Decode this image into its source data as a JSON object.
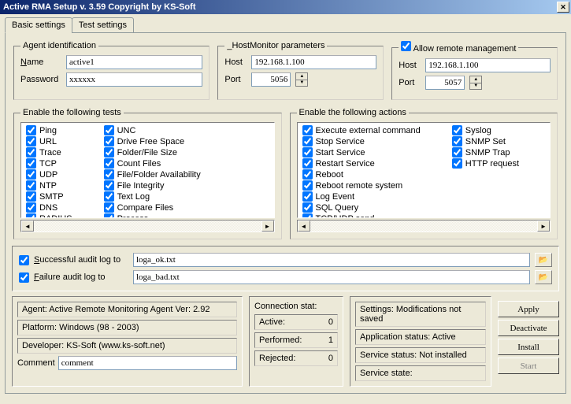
{
  "title": "Active RMA Setup   v. 3.59   Copyright by KS-Soft",
  "tabs": {
    "basic": "Basic settings",
    "test": "Test settings"
  },
  "agent_id": {
    "legend": "Agent identification",
    "name_label": "Name",
    "name_value": "active1",
    "password_label": "Password",
    "password_value": "xxxxxx"
  },
  "hostmonitor": {
    "legend": "_HostMonitor parameters",
    "host_label": "Host",
    "host_value": "192.168.1.100",
    "port_label": "Port",
    "port_value": "5056"
  },
  "remote": {
    "allow": "Allow remote management",
    "host_label": "Host",
    "host_value": "192.168.1.100",
    "port_label": "Port",
    "port_value": "5057"
  },
  "tests": {
    "legend": "Enable the following tests",
    "col1": [
      "Ping",
      "URL",
      "Trace",
      "TCP",
      "UDP",
      "NTP",
      "SMTP",
      "DNS",
      "RADIUS"
    ],
    "col2": [
      "UNC",
      "Drive Free Space",
      "Folder/File Size",
      "Count Files",
      "File/Folder Availability",
      "File Integrity",
      "Text Log",
      "Compare Files",
      "Process"
    ]
  },
  "actions": {
    "legend": "Enable the following actions",
    "col1": [
      "Execute external command",
      "Stop Service",
      "Start Service",
      "Restart Service",
      "Reboot",
      "Reboot remote system",
      "Log Event",
      "SQL Query",
      "TCP/UDP send"
    ],
    "col2": [
      "Syslog",
      "SNMP Set",
      "SNMP Trap",
      "HTTP request"
    ]
  },
  "audit": {
    "success_label": "Successful audit log to",
    "success_value": "loga_ok.txt",
    "failure_label": "Failure audit log to",
    "failure_value": "loga_bad.txt"
  },
  "info": {
    "agent": "Agent: Active Remote Monitoring Agent       Ver: 2.92",
    "platform": "Platform: Windows (98 - 2003)",
    "developer": "Developer: KS-Soft (www.ks-soft.net)",
    "comment_label": "Comment",
    "comment_value": "comment"
  },
  "stats": {
    "legend": "Connection stat:",
    "active_label": "Active:",
    "active_value": "0",
    "performed_label": "Performed:",
    "performed_value": "1",
    "rejected_label": "Rejected:",
    "rejected_value": "0"
  },
  "status": {
    "settings": "Settings: Modifications not saved",
    "app": "Application status: Active",
    "service": "Service status: Not installed",
    "state": "Service state:"
  },
  "buttons": {
    "apply": "Apply",
    "deactivate": "Deactivate",
    "install": "Install",
    "start": "Start"
  }
}
